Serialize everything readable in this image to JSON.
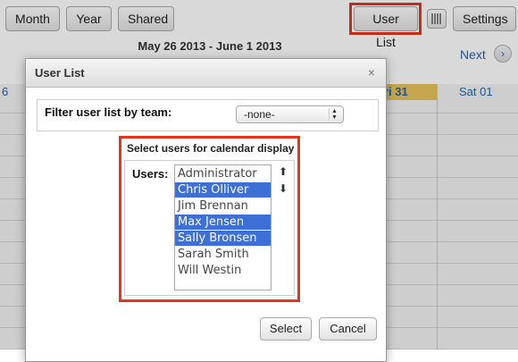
{
  "toolbar": {
    "month_label": "Month",
    "year_label": "Year",
    "shared_label": "Shared",
    "user_list_label": "User List",
    "settings_label": "Settings",
    "calendar_icon": "calendar-icon"
  },
  "calendar": {
    "date_range": "May 26 2013 - June 1 2013",
    "next_label": "Next",
    "next_icon": "chevron-right",
    "days": [
      {
        "label": "6"
      },
      {
        "label": "ri 31"
      },
      {
        "label": "Sat 01"
      }
    ]
  },
  "dialog": {
    "title": "User List",
    "close_icon": "×",
    "filter_label": "Filter user list by team:",
    "filter_value": "-none-",
    "select_heading": "Select users for calendar display",
    "users_label": "Users:",
    "users": [
      {
        "name": "Administrator",
        "selected": false
      },
      {
        "name": "Chris Olliver",
        "selected": true
      },
      {
        "name": "Jim Brennan",
        "selected": false
      },
      {
        "name": "Max Jensen",
        "selected": true
      },
      {
        "name": "Sally Bronsen",
        "selected": true
      },
      {
        "name": "Sarah Smith",
        "selected": false
      },
      {
        "name": "Will Westin",
        "selected": false
      }
    ],
    "move_up_icon": "🠅",
    "move_down_icon": "🠇",
    "select_button": "Select",
    "cancel_button": "Cancel"
  },
  "colors": {
    "highlight": "#e8341c",
    "selection": "#3d6fd7",
    "today": "#e8c35a",
    "link": "#1f63b0"
  }
}
